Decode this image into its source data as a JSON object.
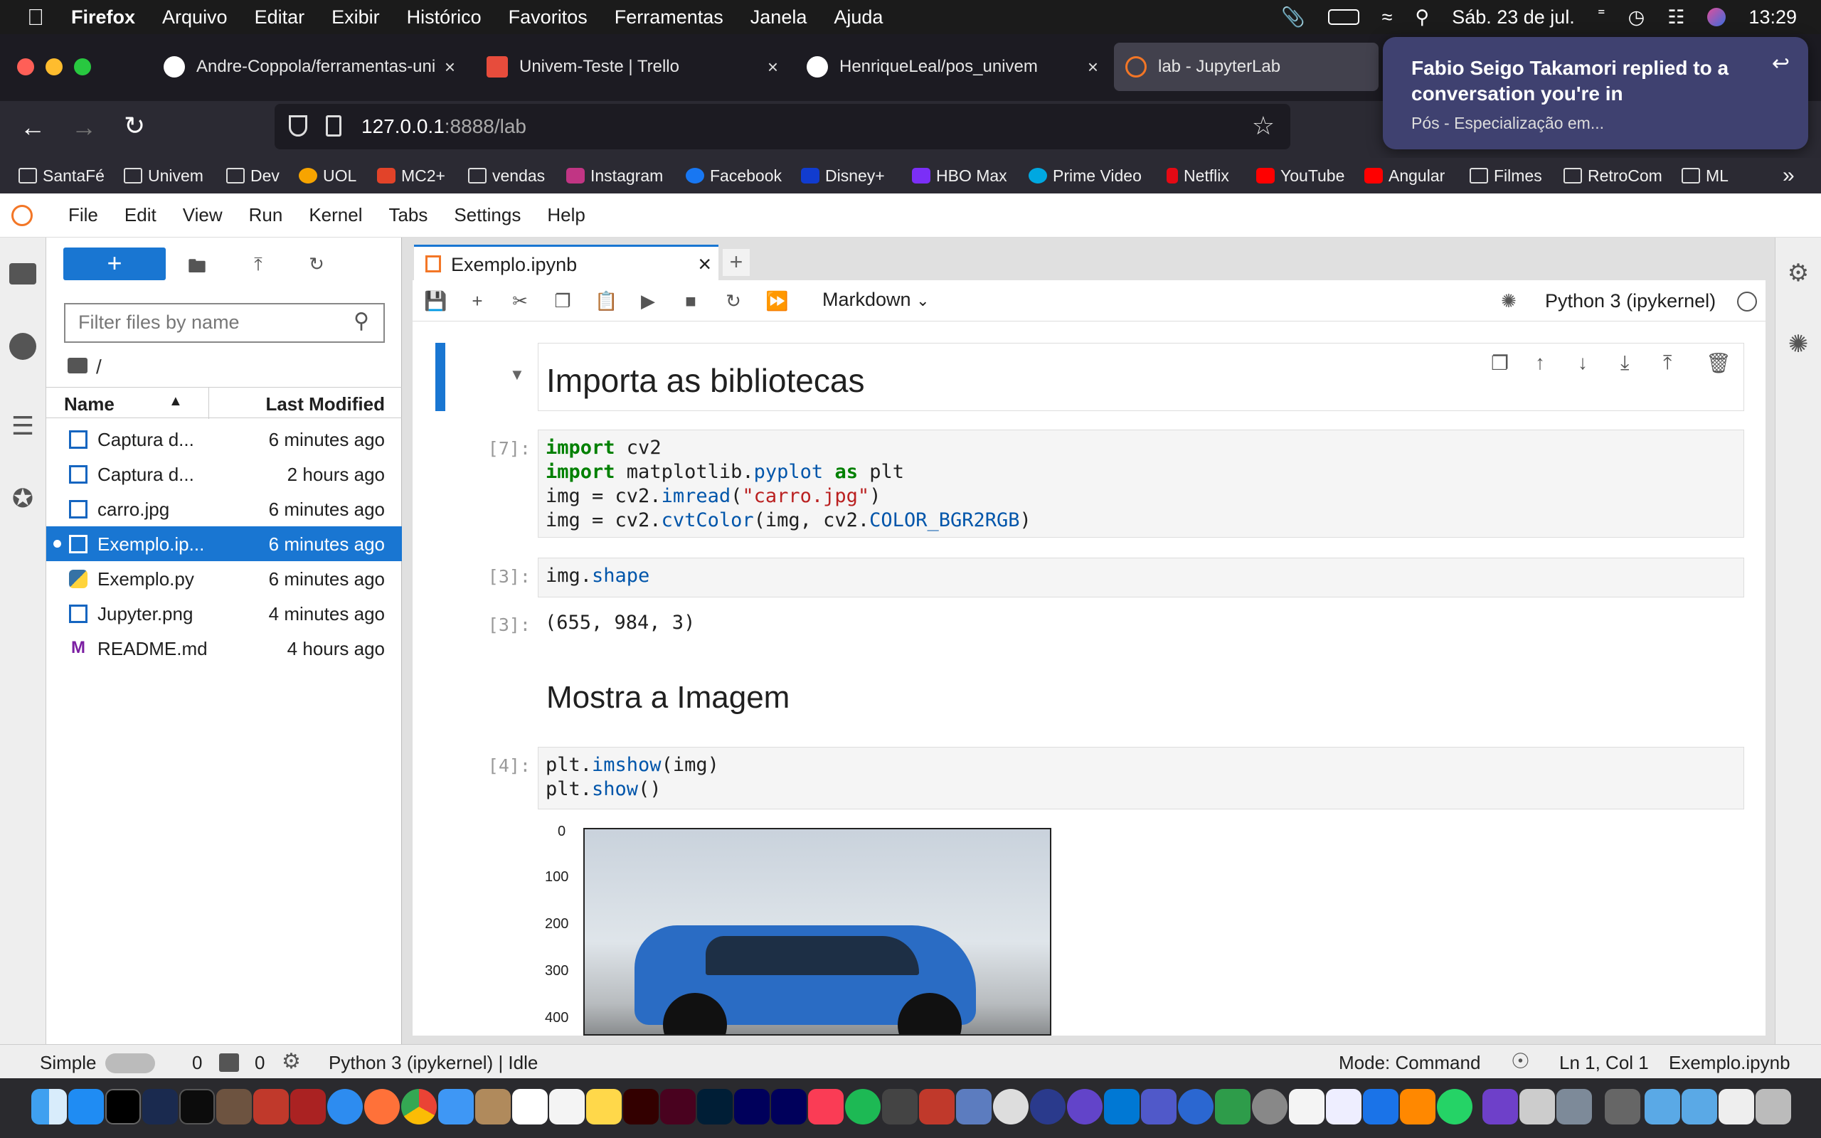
{
  "menubar": {
    "app": "Firefox",
    "items": [
      "Arquivo",
      "Editar",
      "Exibir",
      "Histórico",
      "Favoritos",
      "Ferramentas",
      "Janela",
      "Ajuda"
    ],
    "date": "Sáb. 23 de jul.",
    "time": "13:29"
  },
  "tabs": [
    {
      "title": "Andre-Coppola/ferramentas-uni"
    },
    {
      "title": "Univem-Teste | Trello"
    },
    {
      "title": "HenriqueLeal/pos_univem"
    },
    {
      "title": "lab - JupyterLab"
    }
  ],
  "url": {
    "host": "127.0.0.1",
    "rest": ":8888/lab"
  },
  "bookmarks": [
    "SantaFé",
    "Univem",
    "Dev",
    "UOL",
    "MC2+",
    "vendas",
    "Instagram",
    "Facebook",
    "Disney+",
    "HBO Max",
    "Prime Video",
    "Netflix",
    "YouTube",
    "Angular",
    "Filmes",
    "RetroCom",
    "ML"
  ],
  "notification": {
    "title": "Fabio Seigo Takamori replied to a conversation you're in",
    "body": "Pós - Especialização em..."
  },
  "jmenu": [
    "File",
    "Edit",
    "View",
    "Run",
    "Kernel",
    "Tabs",
    "Settings",
    "Help"
  ],
  "filebrowser": {
    "new_label": "+",
    "filter_placeholder": "Filter files by name",
    "crumb": "/",
    "col_name": "Name",
    "col_modified": "Last Modified",
    "files": [
      {
        "name": "Captura d...",
        "mod": "6 minutes ago"
      },
      {
        "name": "Captura d...",
        "mod": "2 hours ago"
      },
      {
        "name": "carro.jpg",
        "mod": "6 minutes ago"
      },
      {
        "name": "Exemplo.ip...",
        "mod": "6 minutes ago"
      },
      {
        "name": "Exemplo.py",
        "mod": "6 minutes ago"
      },
      {
        "name": "Jupyter.png",
        "mod": "4 minutes ago"
      },
      {
        "name": "README.md",
        "mod": "4 hours ago"
      }
    ]
  },
  "notebook": {
    "tab": "Exemplo.ipynb",
    "cell_type": "Markdown",
    "kernel": "Python 3 (ipykernel)",
    "h1": "Importa as bibliotecas",
    "h2": "Mostra a Imagem",
    "p7": "[7]:",
    "p3": "[3]:",
    "p3o": "[3]:",
    "p4": "[4]:",
    "out3": "(655, 984, 3)",
    "yticks": [
      "0",
      "100",
      "200",
      "300",
      "400"
    ]
  },
  "status": {
    "mode_label": "Simple",
    "n1": "0",
    "n2": "0",
    "kernel_status": "Python 3 (ipykernel) | Idle",
    "mode": "Mode: Command",
    "pos": "Ln 1, Col 1",
    "file": "Exemplo.ipynb"
  },
  "colors": {
    "accent": "#1976d2",
    "dark": "#1c1b22"
  }
}
